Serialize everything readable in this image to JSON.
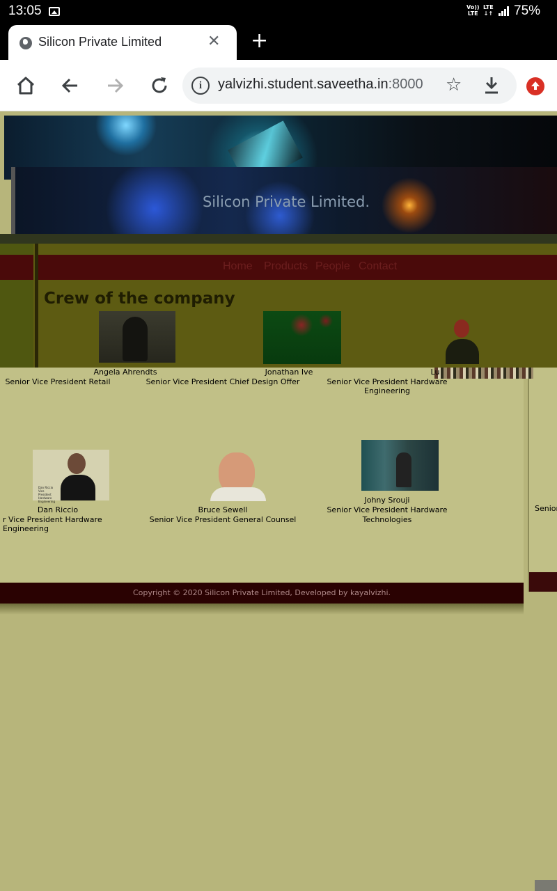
{
  "status_bar": {
    "time": "13:05",
    "net1_top": "Vo))",
    "net1_bottom": "LTE",
    "net2_top": "LTE",
    "net2_bottom": "↓↑",
    "battery": "75%"
  },
  "browser": {
    "tab_title": "Silicon Private Limited",
    "tab_close": "✕",
    "new_tab": "+",
    "url_host": "yalvizhi.student.saveetha.in",
    "url_port": ":8000",
    "star": "☆"
  },
  "site": {
    "title": "Silicon Private Limited.",
    "nav": [
      "Home",
      "Products",
      "People",
      "Contact"
    ],
    "section_title": "Crew of the company",
    "crew_row1": [
      {
        "name": "Angela Ahrendts",
        "role": "Senior Vice President Retail"
      },
      {
        "name": "Jonathan Ive",
        "role": "Senior Vice President Chief Design Offer"
      },
      {
        "name": "Lu",
        "role": "Senior Vice President Hardware Engineering"
      }
    ],
    "crew_row2": [
      {
        "name": "Dan Riccio",
        "role": "r Vice President Hardware Engineering",
        "photo_tag": "Dan Riccio Vice President Hardware Engineering"
      },
      {
        "name": "Bruce Sewell",
        "role": "Senior Vice President General Counsel"
      },
      {
        "name": "Johny Srouji",
        "role_line1": "Senior Vice President Hardware",
        "role_line2": "Technologies"
      }
    ],
    "right_partial": "Senior",
    "footer": "Copyright © 2020 Silicon Private Limited, Developed by kayalvizhi."
  },
  "colors": {
    "page_bg": "#b7b57b",
    "panel_light": "#c1c087",
    "nav_bg": "#4a0a0a",
    "footer_bg": "#2a0202"
  }
}
